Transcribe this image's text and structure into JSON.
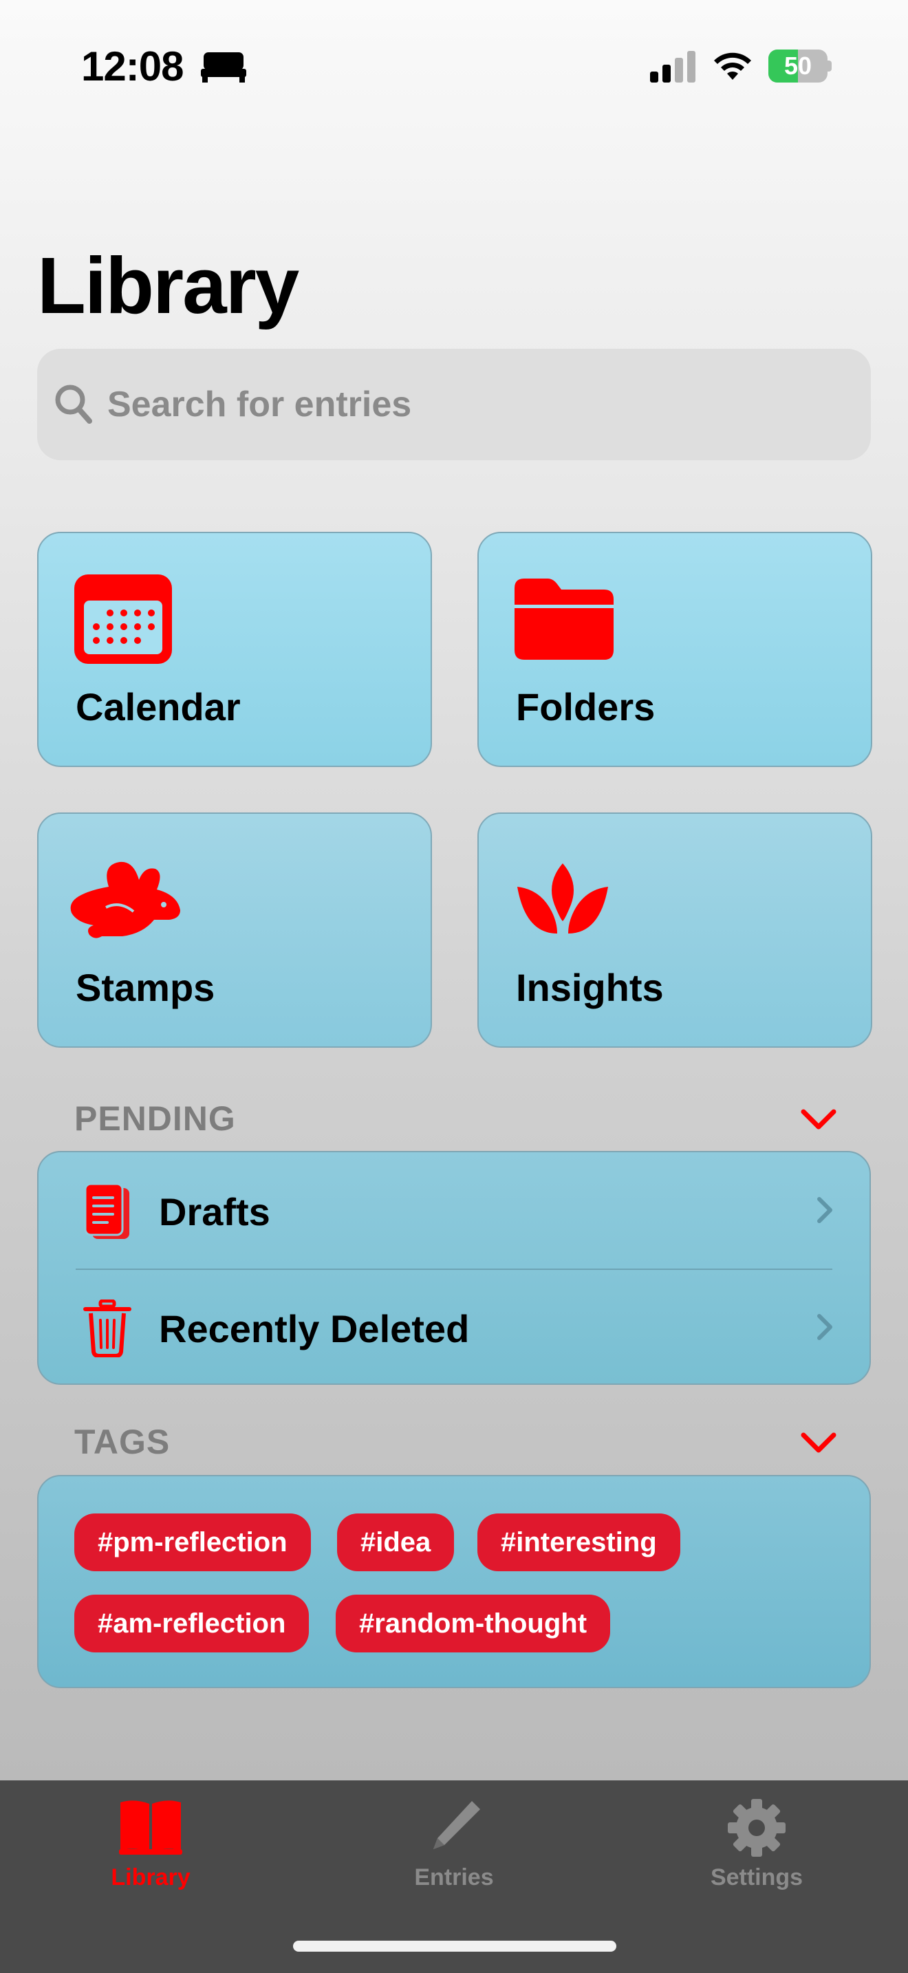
{
  "status_bar": {
    "time": "12:08",
    "battery_level": "50",
    "battery_fraction": 0.5,
    "icons": [
      "bed-icon",
      "signal-icon",
      "wifi-icon",
      "battery-icon"
    ]
  },
  "page": {
    "title": "Library"
  },
  "search": {
    "placeholder": "Search for entries",
    "value": ""
  },
  "cards": [
    {
      "label": "Calendar",
      "icon": "calendar-icon"
    },
    {
      "label": "Folders",
      "icon": "folder-icon"
    },
    {
      "label": "Stamps",
      "icon": "rabbit-icon"
    },
    {
      "label": "Insights",
      "icon": "lotus-icon"
    }
  ],
  "pending": {
    "header": "PENDING",
    "items": [
      {
        "label": "Drafts",
        "icon": "document-icon"
      },
      {
        "label": "Recently Deleted",
        "icon": "trash-icon"
      }
    ]
  },
  "tags": {
    "header": "TAGS",
    "items": [
      "#pm-reflection",
      "#idea",
      "#interesting",
      "#am-reflection",
      "#random-thought"
    ]
  },
  "tab_bar": {
    "tabs": [
      {
        "label": "Library",
        "icon": "book-icon",
        "active": true
      },
      {
        "label": "Entries",
        "icon": "pencil-icon",
        "active": false
      },
      {
        "label": "Settings",
        "icon": "gear-icon",
        "active": false
      }
    ]
  },
  "colors": {
    "accent": "#ff0000",
    "tag_background": "#e0182d",
    "card_background": "#a6dff0",
    "tab_bar_background": "#4a4a4a",
    "battery_green": "#35c759"
  }
}
